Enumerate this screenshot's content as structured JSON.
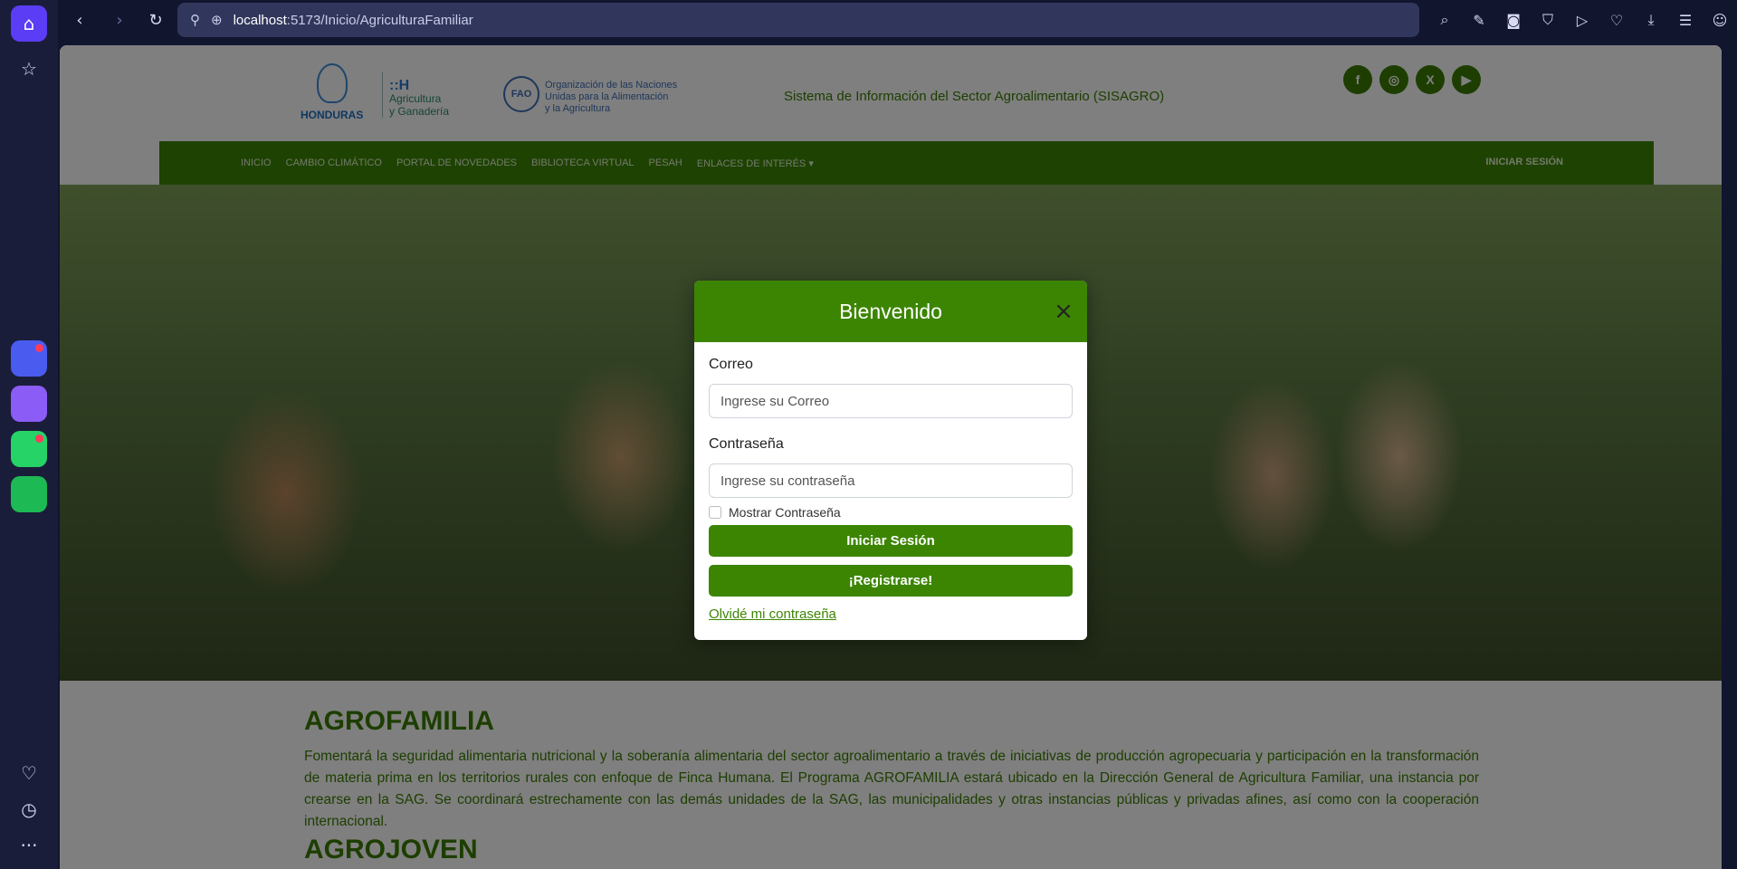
{
  "browser": {
    "url_host": "localhost",
    "url_path": ":5173/Inicio/AgriculturaFamiliar"
  },
  "header": {
    "honduras_logo_text": "HONDURAS",
    "agricultura_logo_line1": "Agricultura",
    "agricultura_logo_line2": "y Ganadería",
    "fao_logo_text": "FAO",
    "fao_line1": "Organización de las Naciones",
    "fao_line2": "Unidas para la Alimentación",
    "fao_line3": "y la Agricultura",
    "site_title": "Sistema de Información del Sector Agroalimentario (SISAGRO)",
    "socials": [
      "f",
      "◎",
      "X",
      "▶"
    ]
  },
  "nav": {
    "items": [
      "INICIO",
      "CAMBIO CLIMÁTICO",
      "PORTAL DE NOVEDADES",
      "BIBLIOTECA VIRTUAL",
      "PESAH",
      "ENLACES DE INTERÉS ▾"
    ],
    "login": "INICIAR SESIÓN"
  },
  "content": {
    "section1_title": "AGROFAMILIA",
    "section1_body": "Fomentará la seguridad alimentaria nutricional y la soberanía alimentaria del sector agroalimentario a través de iniciativas de producción agropecuaria y participación en la transformación de materia prima en los territorios rurales con enfoque de Finca Humana. El Programa AGROFAMILIA estará ubicado en la Dirección General de Agricultura Familiar, una instancia por crearse en la SAG. Se coordinará estrechamente con las demás unidades de la SAG, las municipalidades y otras instancias públicas y privadas afines, así como con la cooperación internacional.",
    "section2_title": "AGROJOVEN"
  },
  "modal": {
    "title": "Bienvenido",
    "close": "×",
    "email_label": "Correo",
    "email_placeholder": "Ingrese su Correo",
    "password_label": "Contraseña",
    "password_placeholder": "Ingrese su contraseña",
    "show_password": "Mostrar Contraseña",
    "login_button": "Iniciar Sesión",
    "register_button": "¡Registrarse!",
    "forgot_link": "Olvidé mi contraseña"
  },
  "colors": {
    "brand_green": "#3c8503",
    "browser_bg": "#12152e",
    "accent": "#5b3df5"
  }
}
